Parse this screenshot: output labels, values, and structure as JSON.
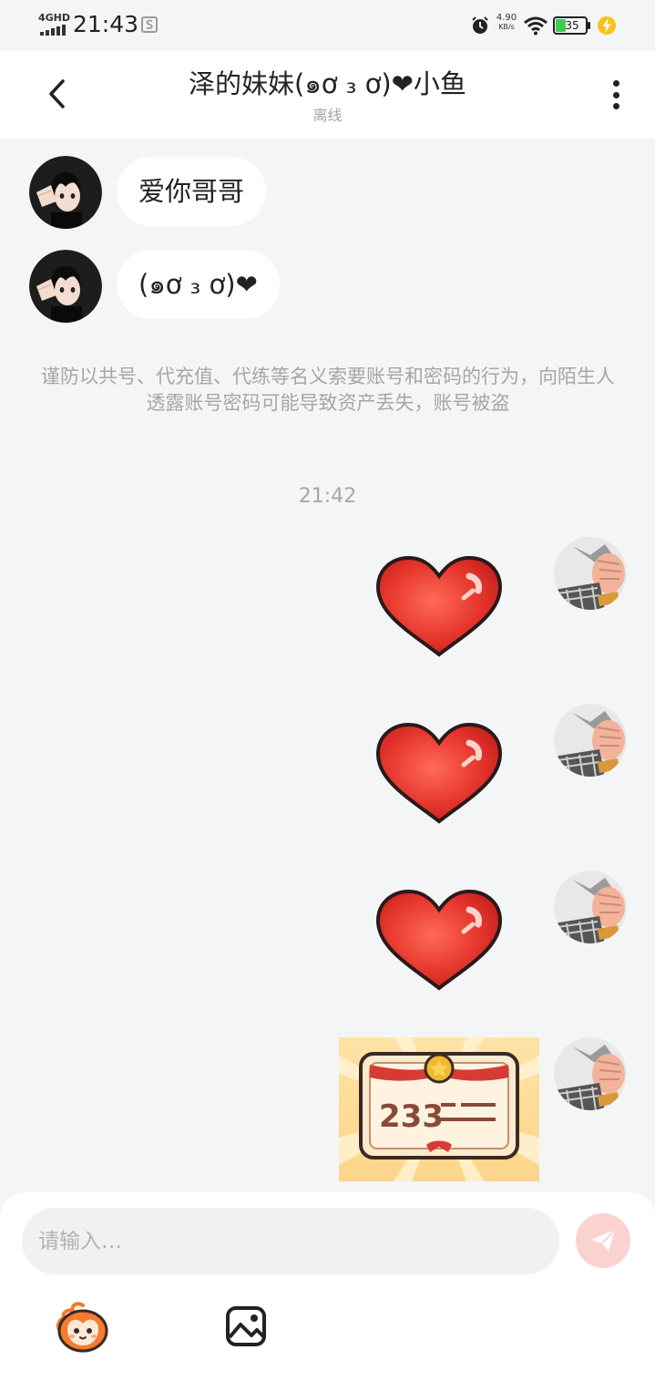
{
  "status_bar": {
    "network": "4GHD",
    "time": "21:43",
    "speed_value": "4.90",
    "speed_unit": "KB/s",
    "battery": "35",
    "icons": [
      "signal-icon",
      "s-app-icon",
      "alarm-icon",
      "wifi-icon",
      "battery-icon",
      "charging-icon"
    ]
  },
  "header": {
    "title": "泽的妹妹(๑ơ ₃ ơ)❤小鱼",
    "status": "离线",
    "icons": [
      "back-arrow-icon",
      "more-vertical-icon"
    ]
  },
  "messages": [
    {
      "side": "left",
      "type": "text",
      "text": "爱你哥哥"
    },
    {
      "side": "left",
      "type": "text",
      "text": "(๑ơ ₃ ơ)❤"
    },
    {
      "side": "right",
      "type": "sticker",
      "sticker": "heart-sticker"
    },
    {
      "side": "right",
      "type": "sticker",
      "sticker": "heart-sticker"
    },
    {
      "side": "right",
      "type": "sticker",
      "sticker": "heart-sticker"
    },
    {
      "side": "right",
      "type": "sticker",
      "sticker": "certificate-sticker",
      "sticker_text": "233"
    }
  ],
  "notice": "谨防以共号、代充值、代练等名义索要账号和密码的行为，向陌生人透露账号密码可能导致资产丢失，账号被盗",
  "timestamp": "21:42",
  "input": {
    "placeholder": "请输入…",
    "value": ""
  },
  "toolbar": {
    "icons": [
      "emoji-mascot-icon",
      "image-icon",
      "send-icon"
    ]
  },
  "colors": {
    "background": "#f4f5f7",
    "bubble": "#ffffff",
    "heart": "#e8392f",
    "send_button": "#fad3d1",
    "battery_fill": "#3ccf4e",
    "charging": "#f7c21b"
  }
}
